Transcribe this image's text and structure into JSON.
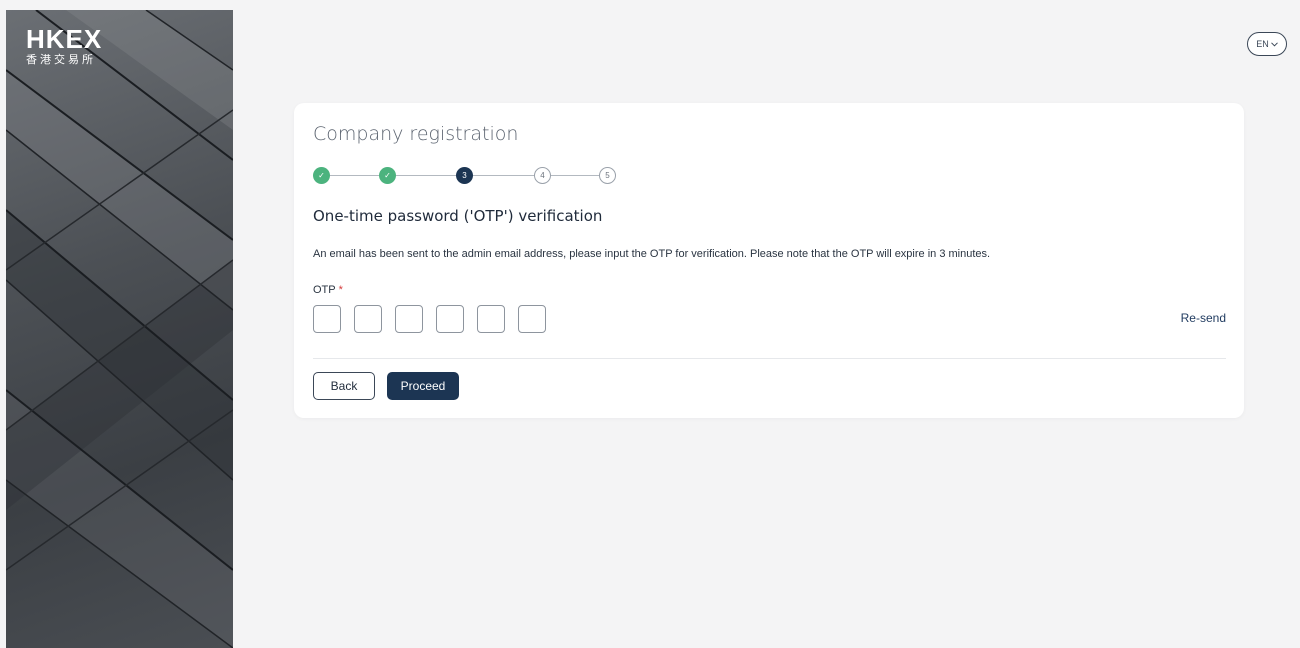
{
  "brand": {
    "logo_text": "HKEX",
    "logo_sub": "香港交易所"
  },
  "header": {
    "lang_label": "EN",
    "lang_icon": "chevron-down-icon"
  },
  "form": {
    "title": "Company registration",
    "steps": [
      {
        "label": "✓",
        "status": "done"
      },
      {
        "label": "✓",
        "status": "done"
      },
      {
        "label": "3",
        "status": "current"
      },
      {
        "label": "4",
        "status": "future"
      },
      {
        "label": "5",
        "status": "future"
      }
    ],
    "section_title": "One-time password ('OTP') verification",
    "description": "An email has been sent to the admin email address, please input the OTP for verification. Please note that the OTP will expire in 3 minutes.",
    "otp_label": "OTP",
    "required_mark": "*",
    "otp_values": [
      "",
      "",
      "",
      "",
      "",
      ""
    ],
    "resend_label": "Re-send",
    "back_label": "Back",
    "proceed_label": "Proceed"
  },
  "colors": {
    "accent": "#1c3553",
    "success": "#4cb37e",
    "required": "#d43b3b",
    "background": "#f4f4f5"
  }
}
